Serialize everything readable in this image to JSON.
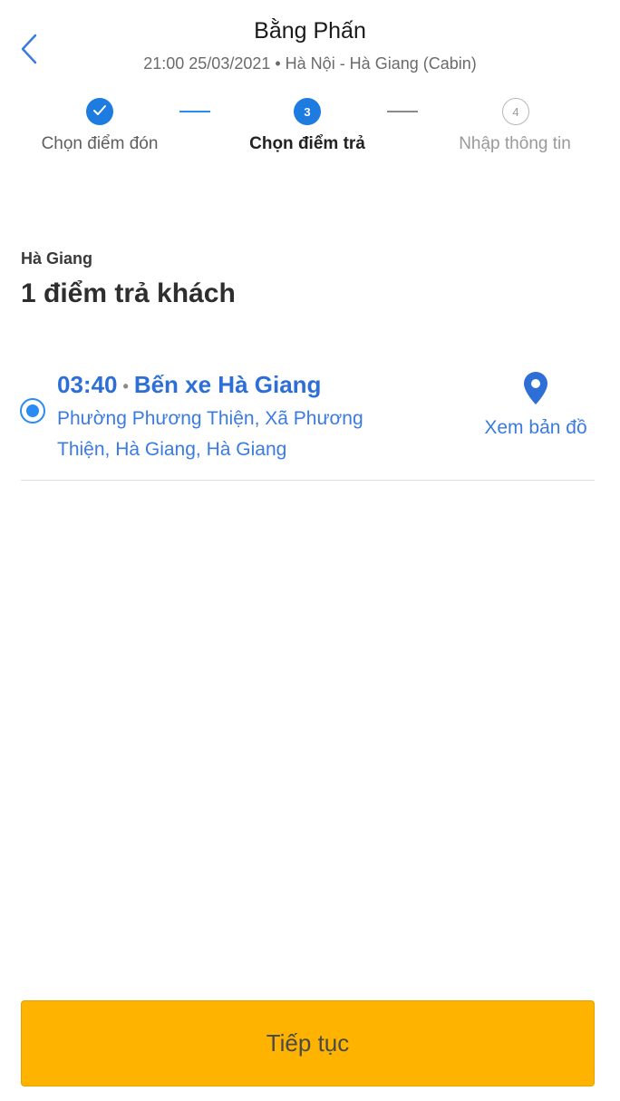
{
  "header": {
    "title": "Bằng Phấn",
    "subtitle": "21:00 25/03/2021 • Hà Nội - Hà Giang (Cabin)",
    "back_icon": "chevron-left-icon"
  },
  "steps": [
    {
      "number": "",
      "label": "Chọn điểm đón",
      "state": "done"
    },
    {
      "number": "3",
      "label": "Chọn điểm trả",
      "state": "active"
    },
    {
      "number": "4",
      "label": "Nhập thông tin",
      "state": "todo"
    }
  ],
  "section": {
    "region": "Hà Giang",
    "count_title": "1 điểm trả khách"
  },
  "stops": [
    {
      "time": "03:40",
      "separator": "•",
      "name": "Bến xe Hà Giang",
      "address": "Phường Phương Thiện, Xã Phương Thiện, Hà Giang, Hà Giang",
      "map_label": "Xem bản đồ",
      "selected": true
    }
  ],
  "footer": {
    "continue_label": "Tiếp tục"
  },
  "colors": {
    "primary": "#1e7be0",
    "link": "#3b7be0",
    "accent_button": "#fdb300"
  }
}
